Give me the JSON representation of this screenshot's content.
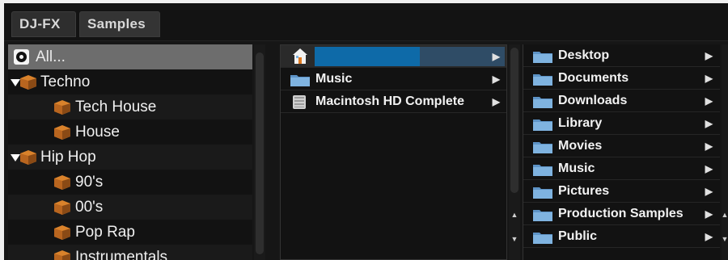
{
  "tabs": [
    {
      "label": "DJ-FX"
    },
    {
      "label": "Samples"
    }
  ],
  "left_tree": [
    {
      "label": "All...",
      "icon": "record-icon",
      "selected": true
    },
    {
      "label": "Techno",
      "icon": "crate-icon",
      "expanded": true
    },
    {
      "label": "Tech House",
      "icon": "crate-icon"
    },
    {
      "label": "House",
      "icon": "crate-icon"
    },
    {
      "label": "Hip Hop",
      "icon": "crate-icon",
      "expanded": true
    },
    {
      "label": "90's",
      "icon": "crate-icon"
    },
    {
      "label": "00's",
      "icon": "crate-icon"
    },
    {
      "label": "Pop Rap",
      "icon": "crate-icon"
    },
    {
      "label": "Instrumentals",
      "icon": "crate-icon"
    }
  ],
  "middle_list": [
    {
      "label": "",
      "icon": "home-icon",
      "selected": true
    },
    {
      "label": "Music",
      "icon": "folder-icon"
    },
    {
      "label": "Macintosh HD Complete",
      "icon": "drive-icon"
    }
  ],
  "right_list": [
    {
      "label": "Desktop",
      "icon": "folder-icon"
    },
    {
      "label": "Documents",
      "icon": "folder-icon"
    },
    {
      "label": "Downloads",
      "icon": "folder-icon"
    },
    {
      "label": "Library",
      "icon": "folder-icon"
    },
    {
      "label": "Movies",
      "icon": "folder-icon"
    },
    {
      "label": "Music",
      "icon": "folder-icon"
    },
    {
      "label": "Pictures",
      "icon": "folder-icon"
    },
    {
      "label": "Production Samples",
      "icon": "folder-icon"
    },
    {
      "label": "Public",
      "icon": "folder-icon"
    }
  ],
  "glyphs": {
    "expand_arrow": "▶",
    "scroll_up": "▲",
    "scroll_down": "▼"
  },
  "colors": {
    "selection_blue": "#0e6aa8",
    "crate_orange": "#d9822b",
    "folder_blue": "#7fb3e0"
  }
}
